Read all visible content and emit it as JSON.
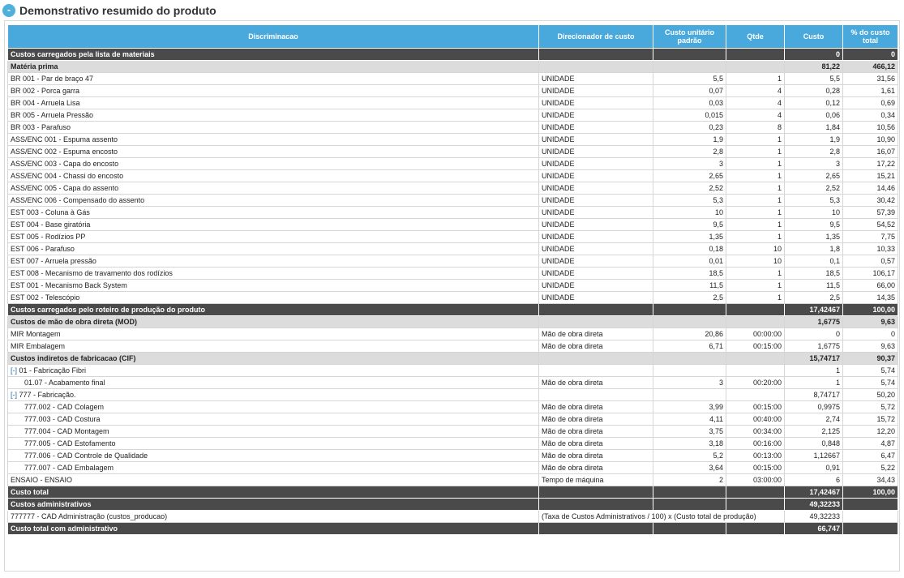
{
  "header": {
    "title": "Demonstrativo resumido do produto",
    "collapse_symbol": "-"
  },
  "columns": [
    "Discriminacao",
    "Direcionador de custo",
    "Custo unitário padrão",
    "Qtde",
    "Custo",
    "% do custo total"
  ],
  "rows": [
    {
      "type": "dark",
      "cells": [
        "Custos carregados pela lista de materiais",
        "",
        "",
        "",
        "0",
        "0"
      ]
    },
    {
      "type": "light",
      "cells": [
        "Matéria prima",
        "",
        "",
        "",
        "81,22",
        "466,12"
      ]
    },
    {
      "type": "plain",
      "cells": [
        "BR 001 - Par de braço 47",
        "UNIDADE",
        "5,5",
        "1",
        "5,5",
        "31,56"
      ]
    },
    {
      "type": "plain",
      "cells": [
        "BR 002 - Porca garra",
        "UNIDADE",
        "0,07",
        "4",
        "0,28",
        "1,61"
      ]
    },
    {
      "type": "plain",
      "cells": [
        "BR 004 - Arruela Lisa",
        "UNIDADE",
        "0,03",
        "4",
        "0,12",
        "0,69"
      ]
    },
    {
      "type": "plain",
      "cells": [
        "BR 005 - Arruela Pressão",
        "UNIDADE",
        "0,015",
        "4",
        "0,06",
        "0,34"
      ]
    },
    {
      "type": "plain",
      "cells": [
        "BR 003 - Parafuso",
        "UNIDADE",
        "0,23",
        "8",
        "1,84",
        "10,56"
      ]
    },
    {
      "type": "plain",
      "cells": [
        "ASS/ENC 001 - Espuma assento",
        "UNIDADE",
        "1,9",
        "1",
        "1,9",
        "10,90"
      ]
    },
    {
      "type": "plain",
      "cells": [
        "ASS/ENC 002 - Espuma encosto",
        "UNIDADE",
        "2,8",
        "1",
        "2,8",
        "16,07"
      ]
    },
    {
      "type": "plain",
      "cells": [
        "ASS/ENC 003 - Capa do encosto",
        "UNIDADE",
        "3",
        "1",
        "3",
        "17,22"
      ]
    },
    {
      "type": "plain",
      "cells": [
        "ASS/ENC 004 - Chassi do encosto",
        "UNIDADE",
        "2,65",
        "1",
        "2,65",
        "15,21"
      ]
    },
    {
      "type": "plain",
      "cells": [
        "ASS/ENC 005 - Capa do assento",
        "UNIDADE",
        "2,52",
        "1",
        "2,52",
        "14,46"
      ]
    },
    {
      "type": "plain",
      "cells": [
        "ASS/ENC 006 - Compensado do assento",
        "UNIDADE",
        "5,3",
        "1",
        "5,3",
        "30,42"
      ]
    },
    {
      "type": "plain",
      "cells": [
        "EST 003 - Coluna à Gás",
        "UNIDADE",
        "10",
        "1",
        "10",
        "57,39"
      ]
    },
    {
      "type": "plain",
      "cells": [
        "EST 004 - Base giratória",
        "UNIDADE",
        "9,5",
        "1",
        "9,5",
        "54,52"
      ]
    },
    {
      "type": "plain",
      "cells": [
        "EST 005 - Rodízios PP",
        "UNIDADE",
        "1,35",
        "1",
        "1,35",
        "7,75"
      ]
    },
    {
      "type": "plain",
      "cells": [
        "EST 006 - Parafuso",
        "UNIDADE",
        "0,18",
        "10",
        "1,8",
        "10,33"
      ]
    },
    {
      "type": "plain",
      "cells": [
        "EST 007 - Arruela pressão",
        "UNIDADE",
        "0,01",
        "10",
        "0,1",
        "0,57"
      ]
    },
    {
      "type": "plain",
      "cells": [
        "EST 008 - Mecanismo de travamento dos rodízios",
        "UNIDADE",
        "18,5",
        "1",
        "18,5",
        "106,17"
      ]
    },
    {
      "type": "plain",
      "cells": [
        "EST 001 - Mecanismo Back System",
        "UNIDADE",
        "11,5",
        "1",
        "11,5",
        "66,00"
      ]
    },
    {
      "type": "plain",
      "cells": [
        "EST 002 - Telescópio",
        "UNIDADE",
        "2,5",
        "1",
        "2,5",
        "14,35"
      ]
    },
    {
      "type": "dark",
      "cells": [
        "Custos carregados pelo roteiro de produção do produto",
        "",
        "",
        "",
        "17,42467",
        "100,00"
      ]
    },
    {
      "type": "light",
      "cells": [
        "Custos de mão de obra direta (MOD)",
        "",
        "",
        "",
        "1,6775",
        "9,63"
      ]
    },
    {
      "type": "plain",
      "cells": [
        "MIR Montagem",
        "Mão de obra direta",
        "20,86",
        "00:00:00",
        "0",
        "0"
      ]
    },
    {
      "type": "plain",
      "cells": [
        "MIR Embalagem",
        "Mão de obra direta",
        "6,71",
        "00:15:00",
        "1,6775",
        "9,63"
      ]
    },
    {
      "type": "light",
      "cells": [
        "Custos indiretos de fabricacao (CIF)",
        "",
        "",
        "",
        "15,74717",
        "90,37"
      ]
    },
    {
      "type": "plain",
      "toggle": "[-]",
      "cells": [
        " 01 - Fabricação Fibri",
        "",
        "",
        "",
        "1",
        "5,74"
      ]
    },
    {
      "type": "plain",
      "indent": true,
      "cells": [
        "01.07 - Acabamento final",
        "Mão de obra direta",
        "3",
        "00:20:00",
        "1",
        "5,74"
      ]
    },
    {
      "type": "plain",
      "toggle": "[-]",
      "cells": [
        " 777 - Fabricação.",
        "",
        "",
        "",
        "8,74717",
        "50,20"
      ]
    },
    {
      "type": "plain",
      "indent": true,
      "cells": [
        "777.002 - CAD Colagem",
        "Mão de obra direta",
        "3,99",
        "00:15:00",
        "0,9975",
        "5,72"
      ]
    },
    {
      "type": "plain",
      "indent": true,
      "cells": [
        "777.003 - CAD Costura",
        "Mão de obra direta",
        "4,11",
        "00:40:00",
        "2,74",
        "15,72"
      ]
    },
    {
      "type": "plain",
      "indent": true,
      "cells": [
        "777.004 - CAD Montagem",
        "Mão de obra direta",
        "3,75",
        "00:34:00",
        "2,125",
        "12,20"
      ]
    },
    {
      "type": "plain",
      "indent": true,
      "cells": [
        "777.005 - CAD Estofamento",
        "Mão de obra direta",
        "3,18",
        "00:16:00",
        "0,848",
        "4,87"
      ]
    },
    {
      "type": "plain",
      "indent": true,
      "cells": [
        "777.006 - CAD Controle de Qualidade",
        "Mão de obra direta",
        "5,2",
        "00:13:00",
        "1,12667",
        "6,47"
      ]
    },
    {
      "type": "plain",
      "indent": true,
      "cells": [
        "777.007 - CAD Embalagem",
        "Mão de obra direta",
        "3,64",
        "00:15:00",
        "0,91",
        "5,22"
      ]
    },
    {
      "type": "plain",
      "cells": [
        "ENSAIO - ENSAIO",
        "Tempo de máquina",
        "2",
        "03:00:00",
        "6",
        "34,43"
      ]
    },
    {
      "type": "dark",
      "cells": [
        "Custo total",
        "",
        "",
        "",
        "17,42467",
        "100,00"
      ]
    },
    {
      "type": "dark",
      "cells": [
        "Custos administrativos",
        "",
        "",
        "",
        "49,32233",
        ""
      ]
    },
    {
      "type": "plain",
      "span": true,
      "cells": [
        "777777 - CAD Administração (custos_producao)",
        "(Taxa de Custos Administrativos / 100) x (Custo total de produção)",
        "",
        "",
        "49,32233",
        ""
      ]
    },
    {
      "type": "dark",
      "cells": [
        "Custo total com administrativo",
        "",
        "",
        "",
        "66,747",
        ""
      ]
    }
  ]
}
